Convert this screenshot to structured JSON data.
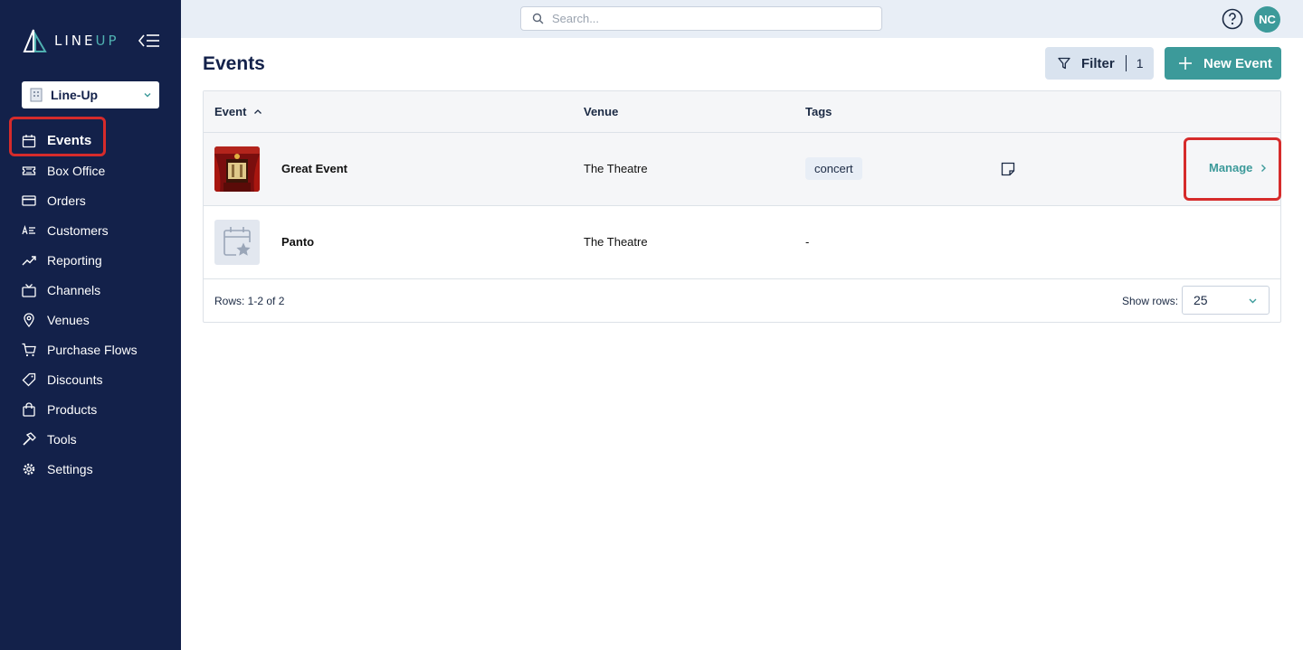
{
  "app": {
    "logo_line": "LINE",
    "logo_up": "UP"
  },
  "sidebar": {
    "org": "Line-Up",
    "items": [
      {
        "label": "Events",
        "icon": "calendar-icon"
      },
      {
        "label": "Box Office",
        "icon": "ticket-icon"
      },
      {
        "label": "Orders",
        "icon": "credit-card-icon"
      },
      {
        "label": "Customers",
        "icon": "contacts-icon"
      },
      {
        "label": "Reporting",
        "icon": "trend-icon"
      },
      {
        "label": "Channels",
        "icon": "tv-icon"
      },
      {
        "label": "Venues",
        "icon": "pin-icon"
      },
      {
        "label": "Purchase Flows",
        "icon": "cart-icon"
      },
      {
        "label": "Discounts",
        "icon": "tag-icon"
      },
      {
        "label": "Products",
        "icon": "bag-icon"
      },
      {
        "label": "Tools",
        "icon": "hammer-icon"
      },
      {
        "label": "Settings",
        "icon": "gear-icon"
      }
    ]
  },
  "topbar": {
    "search_placeholder": "Search...",
    "avatar_initials": "NC"
  },
  "page": {
    "title": "Events"
  },
  "toolbar": {
    "filter_label": "Filter",
    "filter_count": "1",
    "new_label": "New Event"
  },
  "table": {
    "headers": {
      "event": "Event",
      "venue": "Venue",
      "tags": "Tags"
    },
    "rows": [
      {
        "name": "Great Event",
        "venue": "The Theatre",
        "tag": "concert",
        "action": "Manage"
      },
      {
        "name": "Panto",
        "venue": "The Theatre",
        "tag": "-"
      }
    ],
    "footer": {
      "row_count": "Rows: 1-2 of 2",
      "show_rows_label": "Show rows:",
      "show_rows_value": "25"
    }
  },
  "colors": {
    "sidebar": "#13214a",
    "accent": "#3c9a9a",
    "annotation": "#d62b2b"
  }
}
